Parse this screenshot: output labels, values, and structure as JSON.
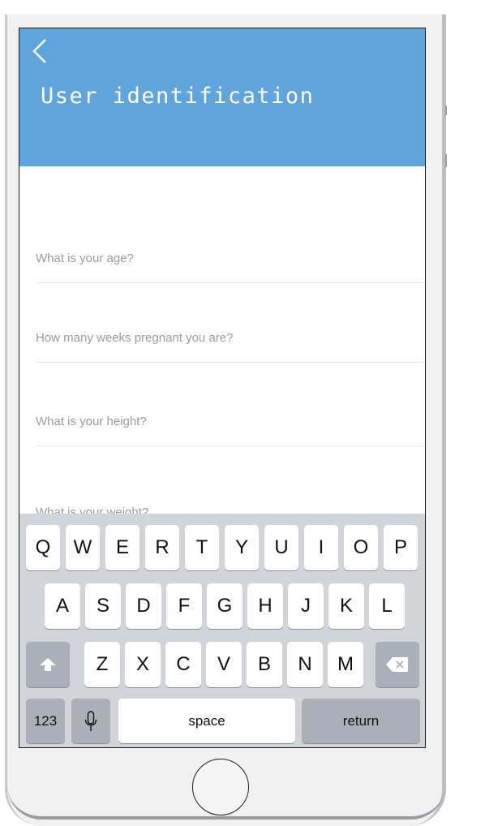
{
  "header": {
    "title": "User identification",
    "back_icon": "chevron-left-icon"
  },
  "form": {
    "fields": [
      {
        "placeholder": "What is your age?"
      },
      {
        "placeholder": "How many weeks pregnant you are?"
      },
      {
        "placeholder": "What is your height?"
      },
      {
        "placeholder": "What is your weight?"
      }
    ]
  },
  "keyboard": {
    "row1": [
      "Q",
      "W",
      "E",
      "R",
      "T",
      "Y",
      "U",
      "I",
      "O",
      "P"
    ],
    "row2": [
      "A",
      "S",
      "D",
      "F",
      "G",
      "H",
      "J",
      "K",
      "L"
    ],
    "row3": [
      "Z",
      "X",
      "C",
      "V",
      "B",
      "N",
      "M"
    ],
    "numbers_label": "123",
    "space_label": "space",
    "return_label": "return",
    "shift_icon": "shift-icon",
    "mic_icon": "microphone-icon",
    "delete_icon": "delete-icon"
  },
  "colors": {
    "header": "#5fa4dd",
    "keyboard": "#d1d4d9",
    "placeholder": "#9a9a9a"
  }
}
